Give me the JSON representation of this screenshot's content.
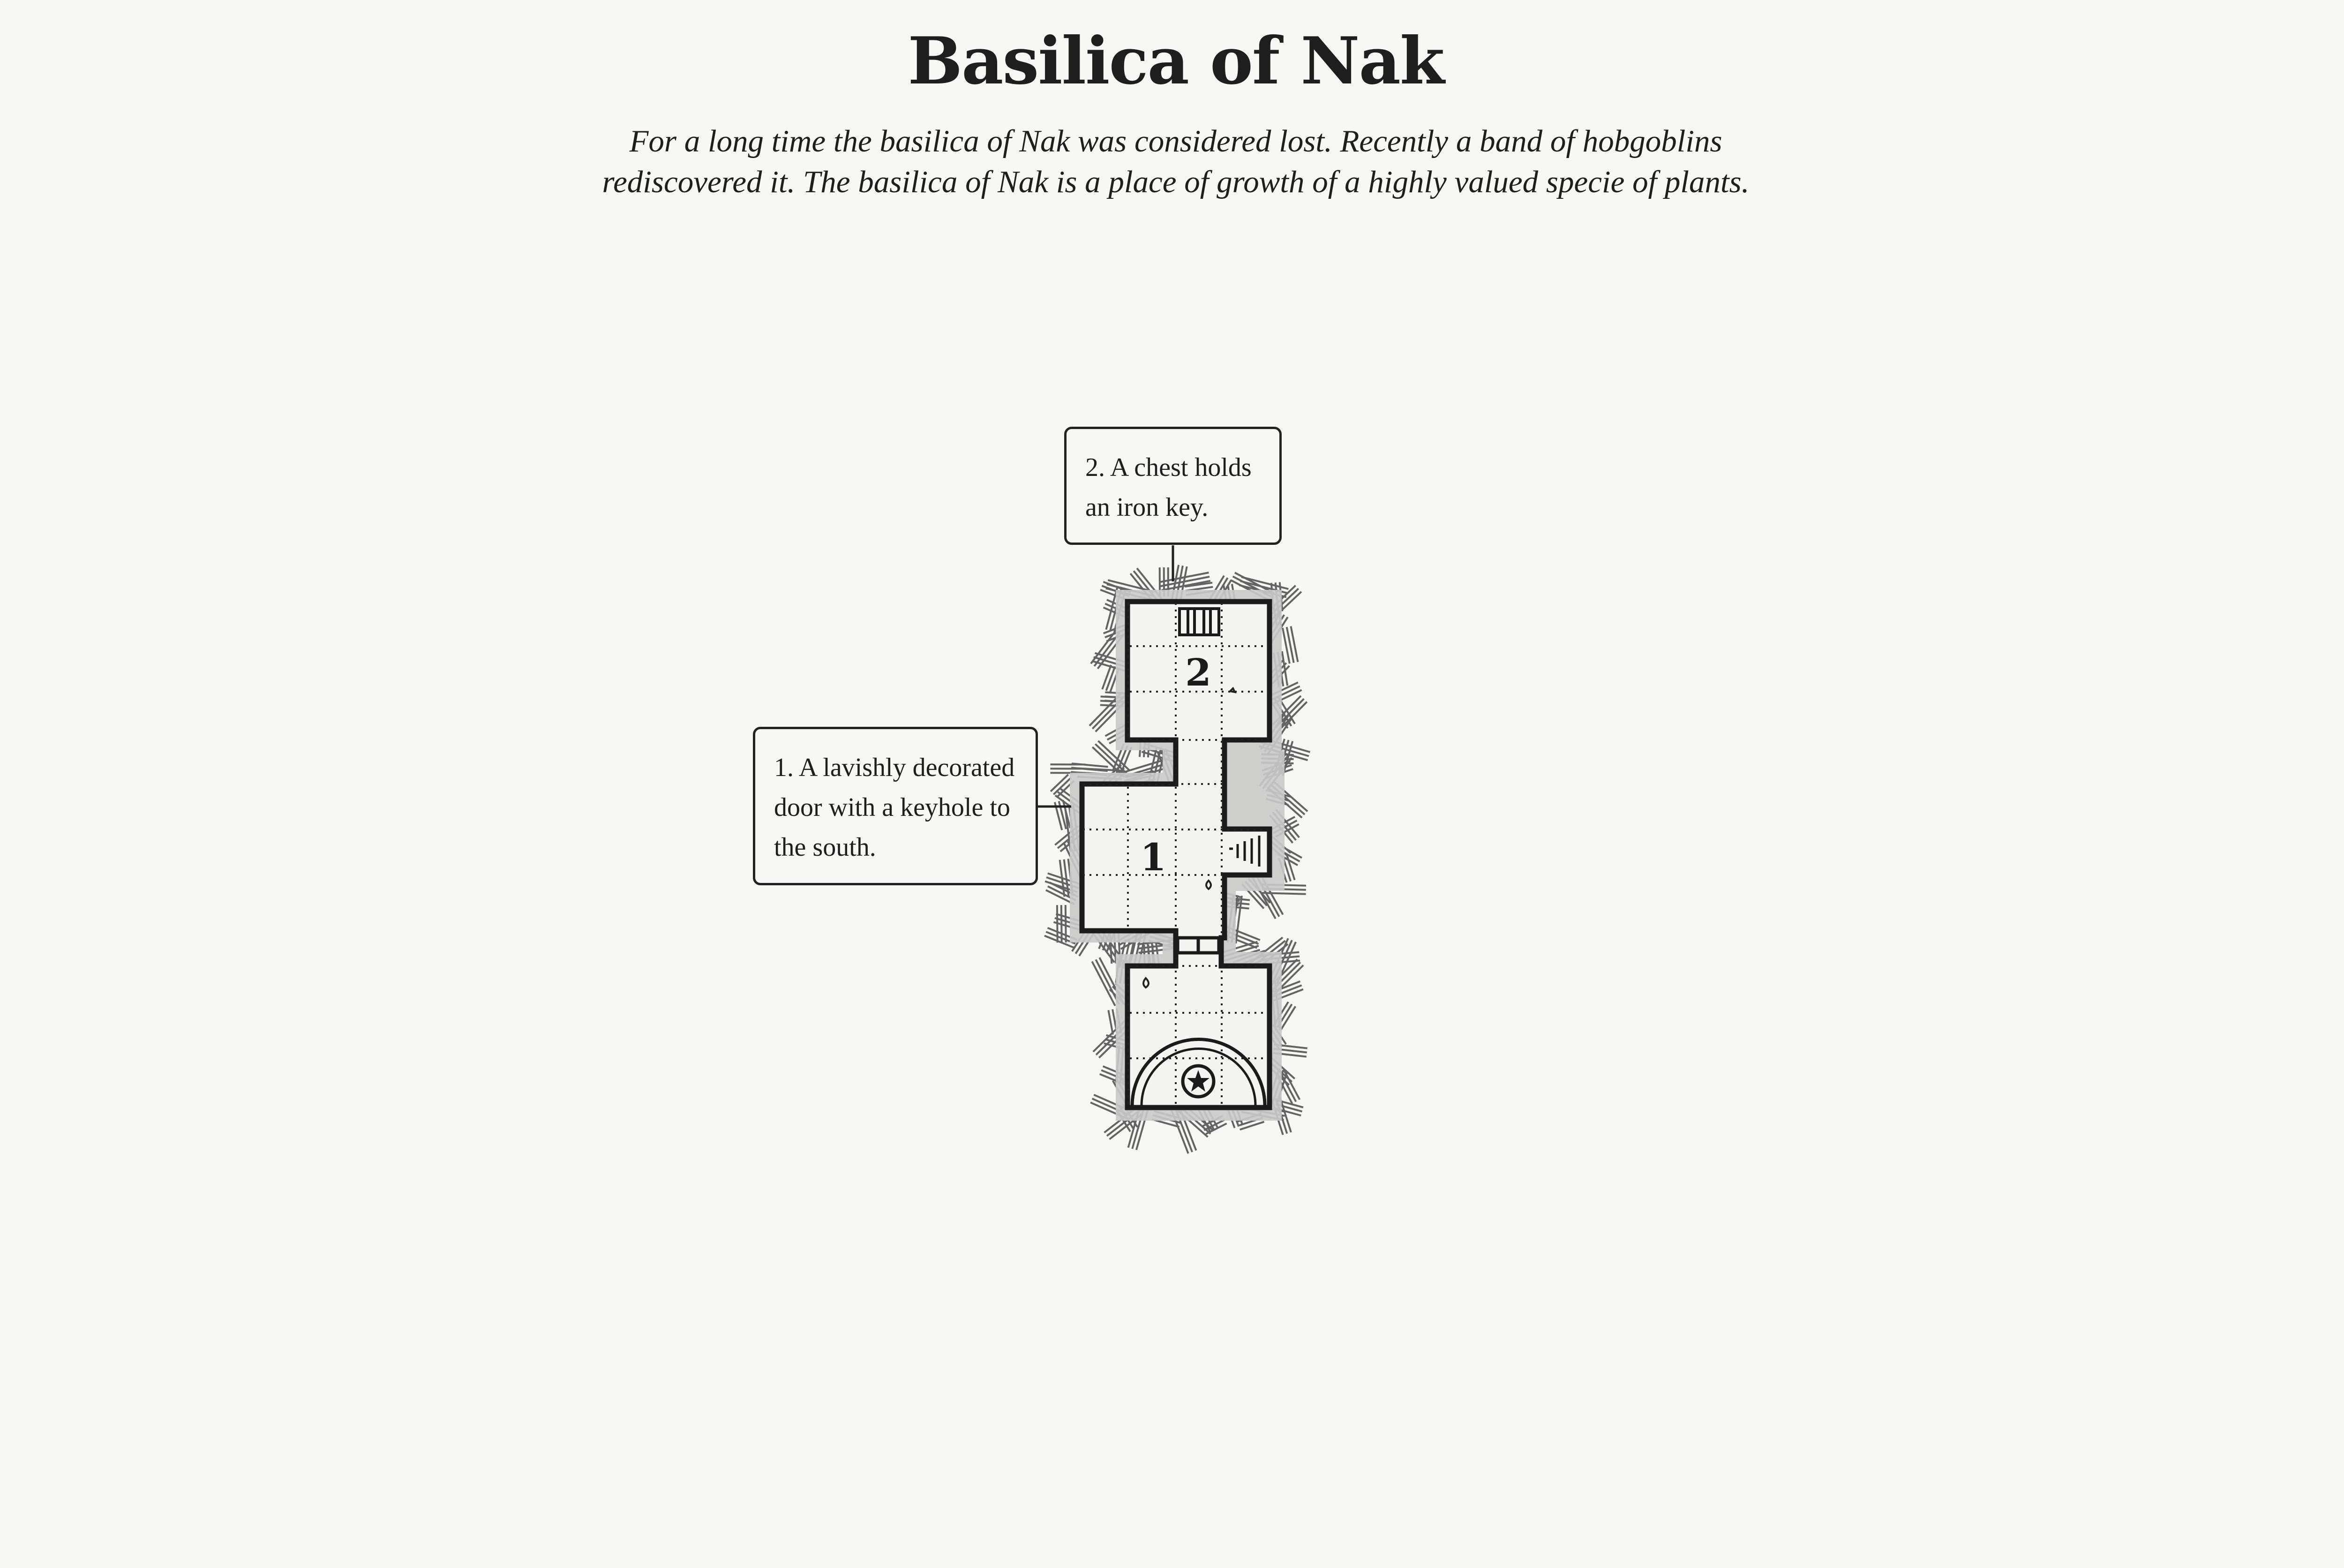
{
  "title": "Basilica of Nak",
  "intro": "For a long time the basilica of Nak was considered lost. Recently a band of hobgoblins rediscovered it. The basilica of Nak is a place of growth of a highly valued specie of plants.",
  "notes": [
    {
      "text": "1. A lavishly decorated door with a keyhole to the south."
    },
    {
      "text": "2. A chest holds an iron key."
    }
  ],
  "rooms": [
    {
      "label": "1"
    },
    {
      "label": "2"
    }
  ],
  "icons": [
    "chest-icon",
    "stairs-icon",
    "altar-star-icon",
    "door-icon"
  ]
}
